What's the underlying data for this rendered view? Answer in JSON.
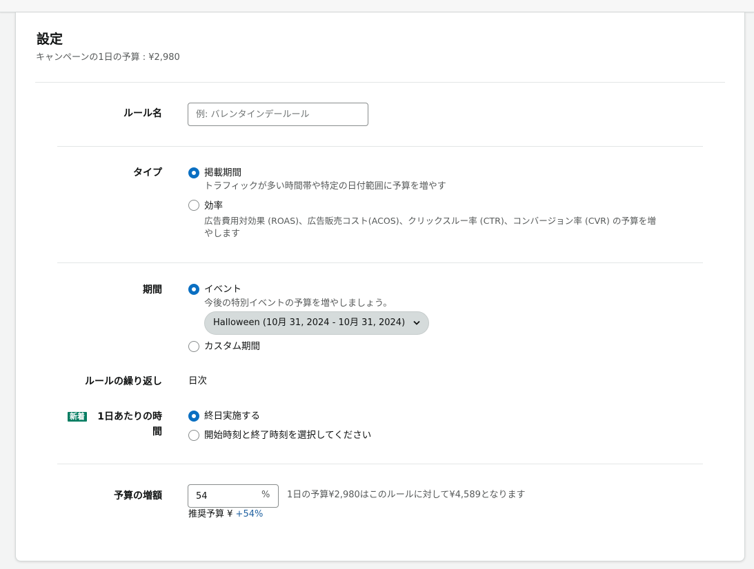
{
  "header": {
    "title": "設定",
    "subtitle": "キャンペーンの1日の予算 : ¥2,980"
  },
  "rule_name": {
    "label": "ルール名",
    "placeholder": "例: バレンタインデールール",
    "value": ""
  },
  "type": {
    "label": "タイプ",
    "options": [
      {
        "label": "掲載期間",
        "description": "トラフィックが多い時間帯や特定の日付範囲に予算を増やす",
        "selected": true
      },
      {
        "label": "効率",
        "description_line1": "広告費用対効果 (ROAS)、広告販売コスト(ACOS)、クリックスルー率 (CTR)、コンバージョン率 (CVR) の予算を増",
        "description_line2": "やします",
        "selected": false
      }
    ]
  },
  "period": {
    "label": "期間",
    "options": [
      {
        "label": "イベント",
        "description": "今後の特別イベントの予算を増やしましょう。",
        "selected": true
      },
      {
        "label": "カスタム期間",
        "selected": false
      }
    ],
    "event_select": "Halloween (10月 31, 2024 - 10月 31, 2024)"
  },
  "recurrence": {
    "label": "ルールの繰り返し",
    "value": "日次"
  },
  "daily_time": {
    "badge": "新着",
    "label_line1": "1日あたりの時",
    "label_line2": "間",
    "options": [
      {
        "label": "終日実施する",
        "selected": true
      },
      {
        "label": "開始時刻と終了時刻を選択してください",
        "selected": false
      }
    ]
  },
  "budget_increase": {
    "label": "予算の増額",
    "value": "54",
    "unit": "%",
    "summary": "1日の予算¥2,980はこのルールに対して¥4,589となります",
    "recommended_prefix": "推奨予算 ¥",
    "recommended_value": "+54%"
  },
  "colors": {
    "radio_selected": "#0a6fc2",
    "badge_bg": "#067d62",
    "link": "#2162a1"
  }
}
